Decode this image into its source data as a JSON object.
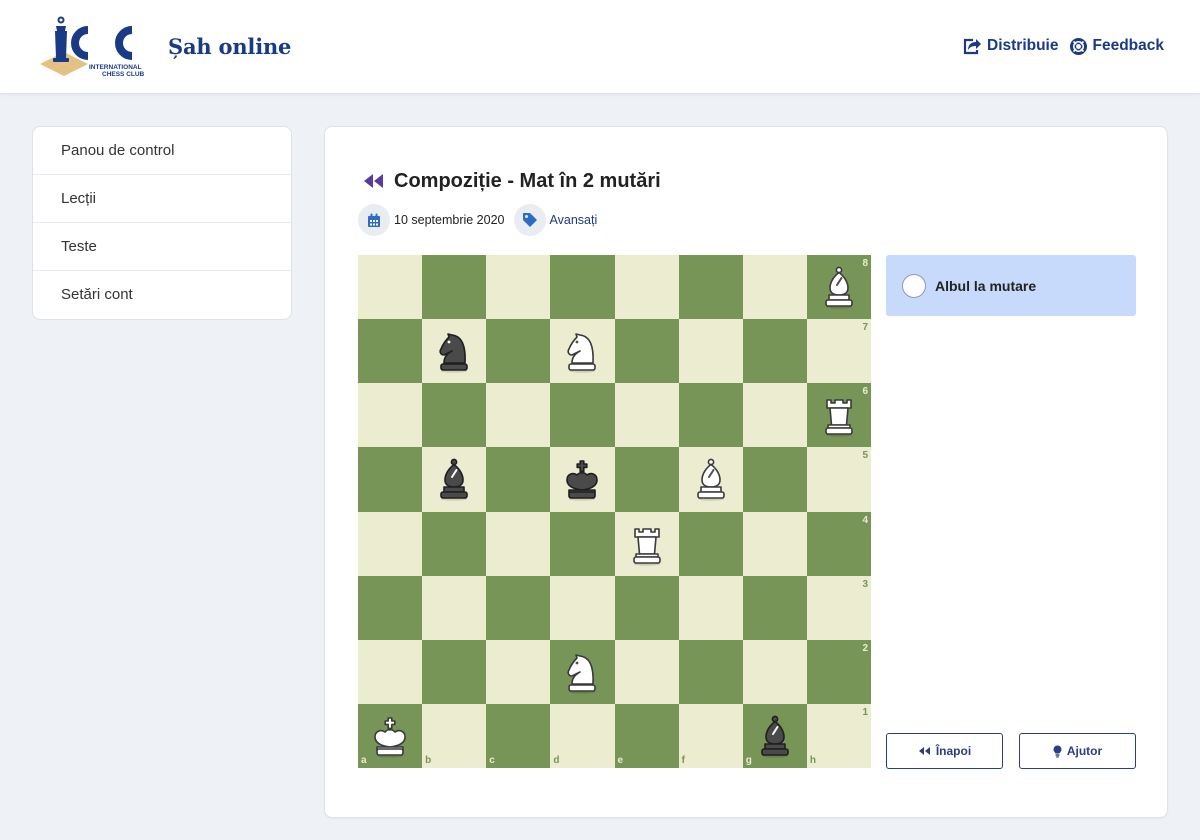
{
  "header": {
    "logo_text": "ICC",
    "logo_subtitle": "INTERNATIONAL CHESS CLUB",
    "site_title": "Șah online",
    "share_label": "Distribuie",
    "feedback_label": "Feedback"
  },
  "sidebar": {
    "items": [
      {
        "label": "Panou de control"
      },
      {
        "label": "Lecții"
      },
      {
        "label": "Teste"
      },
      {
        "label": "Setări cont"
      }
    ]
  },
  "lesson": {
    "title": "Compoziție - Mat în 2 mutări",
    "date": "10 septembrie 2020",
    "level": "Avansați"
  },
  "board": {
    "files": [
      "a",
      "b",
      "c",
      "d",
      "e",
      "f",
      "g",
      "h"
    ],
    "ranks": [
      "8",
      "7",
      "6",
      "5",
      "4",
      "3",
      "2",
      "1"
    ],
    "pieces": [
      {
        "square": "h8",
        "color": "white",
        "type": "bishop"
      },
      {
        "square": "b7",
        "color": "black",
        "type": "knight"
      },
      {
        "square": "d7",
        "color": "white",
        "type": "knight"
      },
      {
        "square": "h6",
        "color": "white",
        "type": "rook"
      },
      {
        "square": "b5",
        "color": "black",
        "type": "bishop"
      },
      {
        "square": "d5",
        "color": "black",
        "type": "king"
      },
      {
        "square": "f5",
        "color": "white",
        "type": "bishop"
      },
      {
        "square": "e4",
        "color": "white",
        "type": "rook"
      },
      {
        "square": "d2",
        "color": "white",
        "type": "knight"
      },
      {
        "square": "a1",
        "color": "white",
        "type": "king"
      },
      {
        "square": "g1",
        "color": "black",
        "type": "bishop"
      }
    ]
  },
  "panel": {
    "turn_text": "Albul la mutare",
    "back_label": "Înapoi",
    "help_label": "Ajutor"
  },
  "colors": {
    "brand": "#1a3a85",
    "light_square": "#ebecd0",
    "dark_square": "#779556",
    "turn_box": "#c7dafc",
    "back_icon": "#5c3a9e"
  }
}
